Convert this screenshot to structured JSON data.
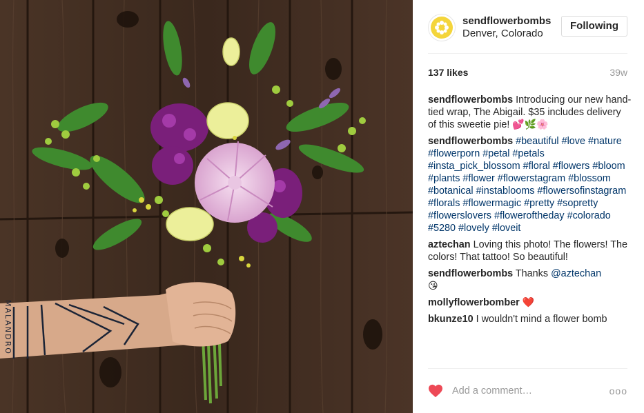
{
  "header": {
    "username": "sendflowerbombs",
    "location": "Denver, Colorado",
    "follow_label": "Following"
  },
  "stats": {
    "likes": "137 likes",
    "time_ago": "39w"
  },
  "caption": {
    "author": "sendflowerbombs",
    "text": " Introducing our new hand-tied wrap, The Abigail. $35 includes delivery of this sweetie pie! ",
    "emojis": "💕🌿🌸"
  },
  "hashtag_comment": {
    "author": "sendflowerbombs",
    "tags": [
      "#beautiful",
      "#love",
      "#nature",
      "#flowerporn",
      "#petal",
      "#petals",
      "#insta_pick_blossom",
      "#floral",
      "#flowers",
      "#bloom",
      "#plants",
      "#flower",
      "#flowerstagram",
      "#blossom",
      "#botanical",
      "#instablooms",
      "#flowersofinstagram",
      "#florals",
      "#flowermagic",
      "#pretty",
      "#sopretty",
      "#flowerslovers",
      "#floweroftheday",
      "#colorado",
      "#5280",
      "#lovely",
      "#loveit"
    ]
  },
  "comments": [
    {
      "author": "aztechan",
      "text": " Loving this photo! The flowers! The colors! That tattoo! So beautiful!",
      "emoji": ""
    },
    {
      "author": "sendflowerbombs",
      "text": " Thanks ",
      "mention": "@aztechan",
      "emoji": "😘"
    },
    {
      "author": "mollyflowerbomber",
      "text": " ",
      "emoji": "❤️"
    },
    {
      "author": "bkunze10",
      "text": " I wouldn't mind a flower bomb",
      "emoji": ""
    }
  ],
  "comment_input": {
    "placeholder": "Add a comment…",
    "more_label": "ooo"
  },
  "colors": {
    "heart": "#ed4956",
    "hashtag": "#003569",
    "muted": "#999999",
    "avatar_yellow": "#f4d53b"
  },
  "image": {
    "tattoo_text": "MALANDRO"
  }
}
